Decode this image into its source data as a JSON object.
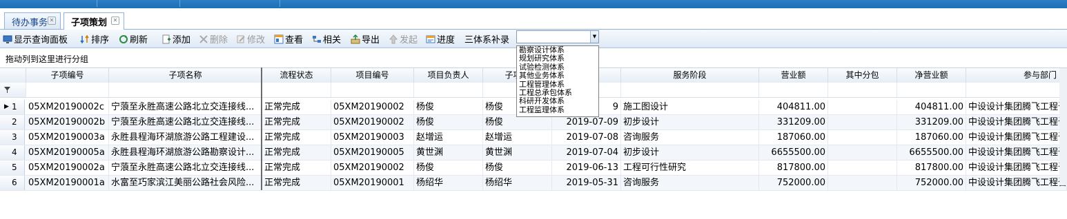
{
  "tabs": [
    {
      "label": "待办事务",
      "active": false
    },
    {
      "label": "子项策划",
      "active": true
    }
  ],
  "toolbar": {
    "items": [
      {
        "label": "显示查询面板",
        "icon": "monitor-icon",
        "disabled": false
      },
      {
        "label": "排序",
        "icon": "sort-icon",
        "disabled": false
      },
      {
        "label": "刷新",
        "icon": "refresh-icon",
        "disabled": false
      },
      {
        "label": "添加",
        "icon": "add-icon",
        "disabled": false
      },
      {
        "label": "删除",
        "icon": "delete-icon",
        "disabled": true
      },
      {
        "label": "修改",
        "icon": "edit-icon",
        "disabled": true
      },
      {
        "label": "查看",
        "icon": "view-icon",
        "disabled": false
      },
      {
        "label": "相关",
        "icon": "related-icon",
        "disabled": false
      },
      {
        "label": "导出",
        "icon": "export-icon",
        "disabled": false
      },
      {
        "label": "发起",
        "icon": "launch-icon",
        "disabled": true
      },
      {
        "label": "进度",
        "icon": "progress-icon",
        "disabled": false
      }
    ],
    "system_label": "三体系补录",
    "combo_value": ""
  },
  "dropdown": {
    "options": [
      "勘察设计体系",
      "规划研究体系",
      "试验检测体系",
      "其他业务体系",
      "工程管理体系",
      "工程总承包体系",
      "科研开发体系",
      "工程监理体系"
    ]
  },
  "group_hint": "拖动列到这里进行分组",
  "columns": [
    "子项编号",
    "子项名称",
    "流程状态",
    "项目编号",
    "项目负责人",
    "子项负",
    "",
    "服务阶段",
    "营业额",
    "其中分包",
    "净营业额",
    "参与部门"
  ],
  "rows": [
    {
      "num": "1",
      "current": true,
      "sub_id": "05XM20190002c",
      "name": "宁蒗至永胜高速公路北立交连接线...",
      "status": "正常完成",
      "proj_id": "05XM20190002",
      "pm": "杨俊",
      "sub_lead": "杨俊",
      "date": "9",
      "stage": "施工图设计",
      "revenue": "404811.00",
      "sub": "",
      "net": "404811.00",
      "dept": "中设设计集团腾飞工程咨"
    },
    {
      "num": "2",
      "current": false,
      "sub_id": "05XM20190002b",
      "name": "宁蒗至永胜高速公路北立交连接线...",
      "status": "正常完成",
      "proj_id": "05XM20190002",
      "pm": "杨俊",
      "sub_lead": "杨俊",
      "date": "2019-07-09",
      "stage": "初步设计",
      "revenue": "331209.00",
      "sub": "",
      "net": "331209.00",
      "dept": "中设设计集团腾飞工程咨"
    },
    {
      "num": "3",
      "current": false,
      "sub_id": "05XM20190003a",
      "name": "永胜县程海环湖旅游公路工程建设...",
      "status": "正常完成",
      "proj_id": "05XM20190003",
      "pm": "赵增运",
      "sub_lead": "赵增运",
      "date": "2019-07-08",
      "stage": "咨询服务",
      "revenue": "187060.00",
      "sub": "",
      "net": "187060.00",
      "dept": "中设设计集团腾飞工程咨"
    },
    {
      "num": "4",
      "current": false,
      "sub_id": "05XM20190005a",
      "name": "永胜县程海环湖旅游公路勘察设计...",
      "status": "正常完成",
      "proj_id": "05XM20190005",
      "pm": "黄世渊",
      "sub_lead": "黄世渊",
      "date": "2019-07-04",
      "stage": "初步设计",
      "revenue": "6655500.00",
      "sub": "",
      "net": "6655500.00",
      "dept": "中设设计集团腾飞工程咨"
    },
    {
      "num": "5",
      "current": false,
      "sub_id": "05XM20190002a",
      "name": "宁蒗至永胜高速公路北立交连接线...",
      "status": "正常完成",
      "proj_id": "05XM20190002",
      "pm": "杨俊",
      "sub_lead": "杨俊",
      "date": "2019-06-13",
      "stage": "工程可行性研究",
      "revenue": "817800.00",
      "sub": "",
      "net": "817800.00",
      "dept": "中设设计集团腾飞工程咨"
    },
    {
      "num": "6",
      "current": false,
      "sub_id": "05XM20190001a",
      "name": "水富至巧家滨江美丽公路社会风险...",
      "status": "正常完成",
      "proj_id": "05XM20190001",
      "pm": "杨绍华",
      "sub_lead": "杨绍华",
      "date": "2019-05-31",
      "stage": "咨询服务",
      "revenue": "752000.00",
      "sub": "",
      "net": "752000.00",
      "dept": "中设设计集团腾飞工程咨"
    }
  ]
}
